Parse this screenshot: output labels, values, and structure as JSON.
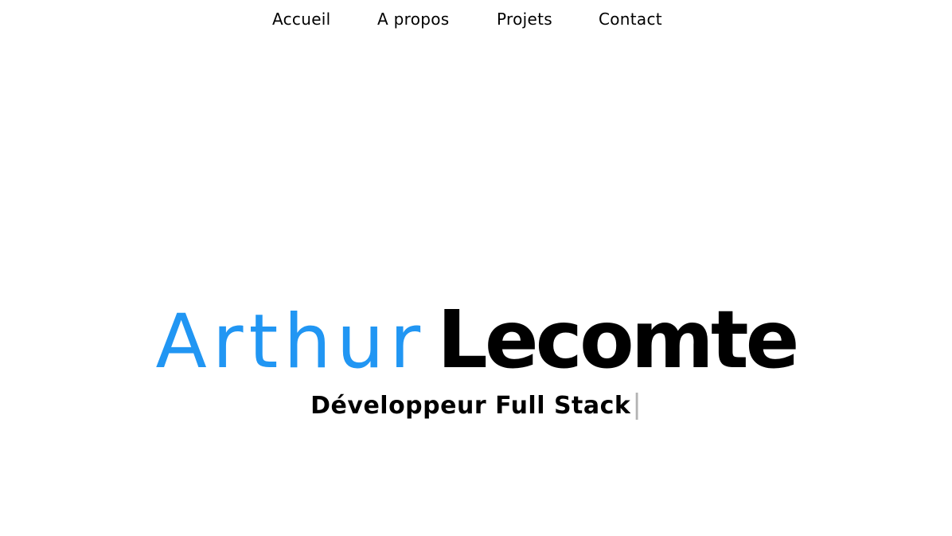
{
  "nav": {
    "items": [
      {
        "label": "Accueil"
      },
      {
        "label": "A propos"
      },
      {
        "label": "Projets"
      },
      {
        "label": "Contact"
      }
    ]
  },
  "hero": {
    "first_name": "Arthur",
    "last_name": "Lecomte",
    "role": "Développeur Full Stack",
    "cursor": "|"
  },
  "colors": {
    "accent": "#2196f3",
    "text": "#000000",
    "cursor": "#b3b3b3",
    "background": "#ffffff"
  }
}
